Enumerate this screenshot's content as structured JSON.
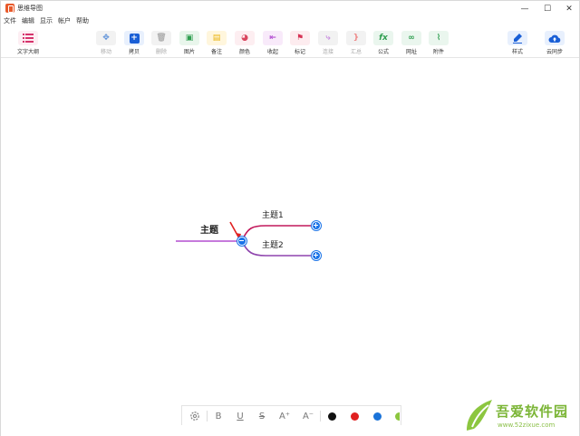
{
  "window": {
    "title": "思维导图",
    "minimize": "—",
    "maximize": "☐",
    "close": "✕"
  },
  "menu": [
    "文件",
    "编辑",
    "显示",
    "帐户",
    "帮助"
  ],
  "toolbar": {
    "outline": {
      "label": "文字大纲",
      "icon": "list-icon"
    },
    "tools": [
      {
        "label": "移动",
        "icon": "move-icon",
        "disabled": true,
        "glyph": "✥"
      },
      {
        "label": "拷贝",
        "icon": "copy-icon",
        "disabled": false,
        "glyph": "+"
      },
      {
        "label": "删除",
        "icon": "trash-icon",
        "disabled": true,
        "glyph": "🗑"
      },
      {
        "label": "图片",
        "icon": "image-icon",
        "disabled": false,
        "glyph": "▣"
      },
      {
        "label": "备注",
        "icon": "note-icon",
        "disabled": false,
        "glyph": "▤"
      },
      {
        "label": "颜色",
        "icon": "palette-icon",
        "disabled": false,
        "glyph": "◕"
      },
      {
        "label": "收起",
        "icon": "collapse-icon",
        "disabled": false,
        "glyph": "⇤"
      },
      {
        "label": "标记",
        "icon": "flag-icon",
        "disabled": false,
        "glyph": "⚑"
      },
      {
        "label": "连接",
        "icon": "connect-icon",
        "disabled": true,
        "glyph": "⤷"
      },
      {
        "label": "汇总",
        "icon": "summary-icon",
        "disabled": true,
        "glyph": "}"
      },
      {
        "label": "公式",
        "icon": "formula-icon",
        "disabled": false,
        "glyph": "fx"
      },
      {
        "label": "网址",
        "icon": "link-icon",
        "disabled": false,
        "glyph": "∞"
      },
      {
        "label": "附件",
        "icon": "attachment-icon",
        "disabled": false,
        "glyph": "⌇"
      }
    ],
    "style": {
      "label": "样式",
      "icon": "brush-icon"
    },
    "sync": {
      "label": "云同步",
      "icon": "cloud-upload-icon"
    }
  },
  "mindmap": {
    "root": "主题",
    "children": [
      "主题1",
      "主题2"
    ]
  },
  "formatbar": {
    "bold": "B",
    "underline": "U",
    "strike": "S",
    "font_up": "A⁺",
    "font_down": "A⁻",
    "colors": [
      "#111111",
      "#e02020",
      "#1a73d9",
      "#8cc63f"
    ]
  },
  "watermark": {
    "text": "吾爱软件园",
    "url": "www.52zixue.com"
  },
  "colors": {
    "branch_root": "#b44fd1",
    "branch_top": "#c2185b",
    "branch_bottom": "#8e44ad",
    "node_blue": "#1a73e8"
  }
}
